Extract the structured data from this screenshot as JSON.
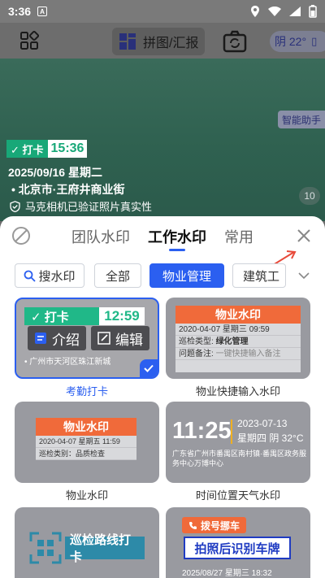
{
  "status_bar": {
    "time": "3:36",
    "notification_letter": "A"
  },
  "toolbar": {
    "pintu_label": "拼图/汇报",
    "weather": "阴 22°"
  },
  "photo": {
    "assistant_label": "智能助手",
    "watermark": {
      "punch_label": "✓ 打卡",
      "time": "15:36",
      "date": "2025/09/16  星期二",
      "location": "• 北京市·王府井商业街",
      "verify": "马克相机已验证照片真实性"
    },
    "count_badge": "10"
  },
  "sheet": {
    "tabs": [
      {
        "label": "团队水印",
        "active": false
      },
      {
        "label": "工作水印",
        "active": true
      },
      {
        "label": "常用",
        "active": false
      }
    ],
    "chips": [
      {
        "label": "搜水印",
        "selected": false
      },
      {
        "label": "全部",
        "selected": false
      },
      {
        "label": "物业管理",
        "selected": true
      },
      {
        "label": "建筑工",
        "selected": false
      }
    ],
    "cards": [
      {
        "label": "考勤打卡",
        "selected": true,
        "punch": "✓ 打卡",
        "time": "12:59",
        "location": "• 广州市天河区珠江新城",
        "intro_label": "介绍",
        "edit_label": "编辑"
      },
      {
        "label": "物业快捷输入水印",
        "head": "物业水印",
        "line1": "2020-04-07 星期三 09:59",
        "line2_key": "巡检类型:",
        "line2_val": "绿化管理",
        "line3_key": "问题备注:",
        "line3_val": "一键快捷输入备注"
      },
      {
        "label": "物业水印",
        "head": "物业水印",
        "line1": "2020-04-07 星期五 11:59",
        "line2": "巡检类别：品质检查"
      },
      {
        "label": "时间位置天气水印",
        "time": "11:25",
        "date": "2023-07-13",
        "week": "星期四 阴 32°C",
        "address": "广东省广州市番禺区南村镇·番禺区政务服务中心万博中心"
      },
      {
        "label": "",
        "text": "巡检路线打卡"
      },
      {
        "label": "",
        "tag": "拨号挪车",
        "plate": "拍照后识别车牌",
        "date": "2025/08/27 星期三 18:32"
      }
    ]
  },
  "colors": {
    "accent": "#2b5ff0",
    "punch_green": "#20b888",
    "orange": "#f06a3a",
    "red_arrow": "#e84a3a"
  }
}
